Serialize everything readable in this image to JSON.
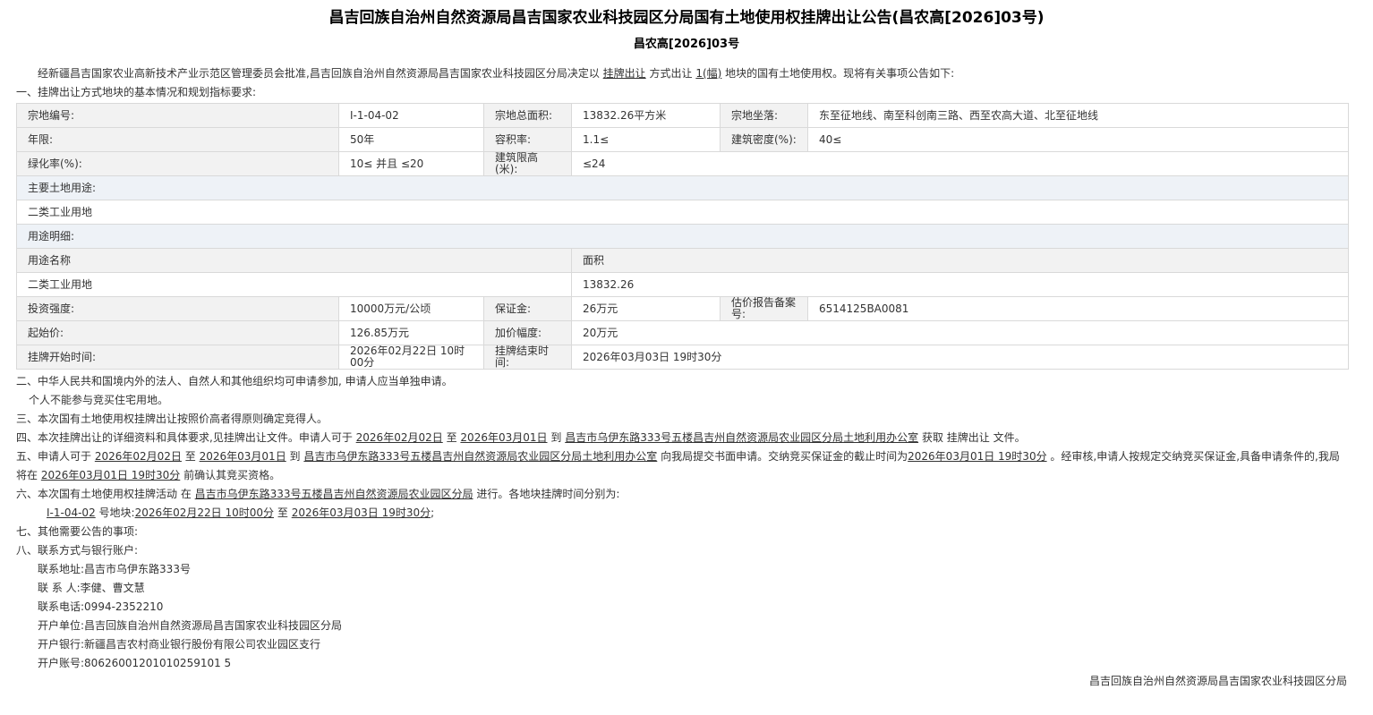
{
  "title": "昌吉回族自治州自然资源局昌吉国家农业科技园区分局国有土地使用权挂牌出让公告(昌农高[2026]03号)",
  "subtitle": "昌农高[2026]03号",
  "intro": {
    "p1": "经新疆昌吉国家农业高新技术产业示范区管理委员会批准,昌吉回族自治州自然资源局昌吉国家农业科技园区分局决定以",
    "method": "挂牌出让",
    "p2": "方式出让",
    "count": "1(幅)",
    "p3": "地块的国有土地使用权。现将有关事项公告如下:"
  },
  "section1": "一、挂牌出让方式地块的基本情况和规划指标要求:",
  "table": {
    "parcel_no_label": "宗地编号:",
    "parcel_no": "I-1-04-02",
    "area_label": "宗地总面积:",
    "area": "13832.26平方米",
    "location_label": "宗地坐落:",
    "location": "东至征地线、南至科创南三路、西至农高大道、北至征地线",
    "term_label": "年限:",
    "term": "50年",
    "far_label": "容积率:",
    "far": "1.1≤",
    "density_label": "建筑密度(%):",
    "density": "40≤",
    "green_label": "绿化率(%):",
    "green": "10≤ 并且 ≤20",
    "height_label": "建筑限高(米):",
    "height": "≤24",
    "main_use_label": "主要土地用途:",
    "main_use": "二类工业用地",
    "use_detail_label": "用途明细:",
    "use_name_header": "用途名称",
    "use_area_header": "面积",
    "use_name": "二类工业用地",
    "use_area": "13832.26",
    "invest_label": "投资强度:",
    "invest": "10000万元/公顷",
    "deposit_label": "保证金:",
    "deposit": "26万元",
    "appraisal_label": "估价报告备案号:",
    "appraisal": "6514125BA0081",
    "start_price_label": "起始价:",
    "start_price": "126.85万元",
    "increment_label": "加价幅度:",
    "increment": "20万元",
    "listing_start_label": "挂牌开始时间:",
    "listing_start": "2026年02月22日 10时00分",
    "listing_end_label": "挂牌结束时间:",
    "listing_end": "2026年03月03日 19时30分"
  },
  "section2": "二、中华人民共和国境内外的法人、自然人和其他组织均可申请参加, 申请人应当单独申请。",
  "section2b": "个人不能参与竞买住宅用地。",
  "section3": "三、本次国有土地使用权挂牌出让按照价高者得原则确定竞得人。",
  "section4": {
    "a": "四、本次挂牌出让的详细资料和具体要求,见挂牌出让文件。申请人可于",
    "d1": "2026年02月02日",
    "b": "至",
    "d2": "2026年03月01日",
    "c": "到",
    "place": "昌吉市乌伊东路333号五楼昌吉州自然资源局农业园区分局土地利用办公室",
    "d": "获取",
    "doc": "挂牌出让",
    "e": "文件。"
  },
  "section5": {
    "a": "五、申请人可于",
    "d1": "2026年02月02日",
    "b": "至",
    "d2": "2026年03月01日",
    "c": "到",
    "place": "昌吉市乌伊东路333号五楼昌吉州自然资源局农业园区分局土地利用办公室",
    "d": "向我局提交书面申请。交纳竞买保证金的截止时间为",
    "deadline": "2026年03月01日 19时30分",
    "e": "。经审核,申请人按规定交纳竞买保证金,具备申请条件的,我局将在",
    "confirm": "2026年03月01日 19时30分",
    "f": "前确认其竞买资格。"
  },
  "section6": {
    "a": "六、本次国有土地使用权挂牌活动 在",
    "place": "昌吉市乌伊东路333号五楼昌吉州自然资源局农业园区分局",
    "b": "进行。各地块挂牌时间分别为:",
    "parcel": "I-1-04-02",
    "c": "号地块:",
    "t1": "2026年02月22日 10时00分",
    "d": "至",
    "t2": "2026年03月03日 19时30分",
    "e": ";"
  },
  "section7": "七、其他需要公告的事项:",
  "section8": "八、联系方式与银行账户:",
  "contact": {
    "address": "联系地址:昌吉市乌伊东路333号",
    "person": "联 系 人:李健、曹文慧",
    "phone": "联系电话:0994-2352210",
    "unit": "开户单位:昌吉回族自治州自然资源局昌吉国家农业科技园区分局",
    "bank": "开户银行:新疆昌吉农村商业银行股份有限公司农业园区支行",
    "account": "开户账号:80626001201010259101 5"
  },
  "footer": "昌吉回族自治州自然资源局昌吉国家农业科技园区分局"
}
